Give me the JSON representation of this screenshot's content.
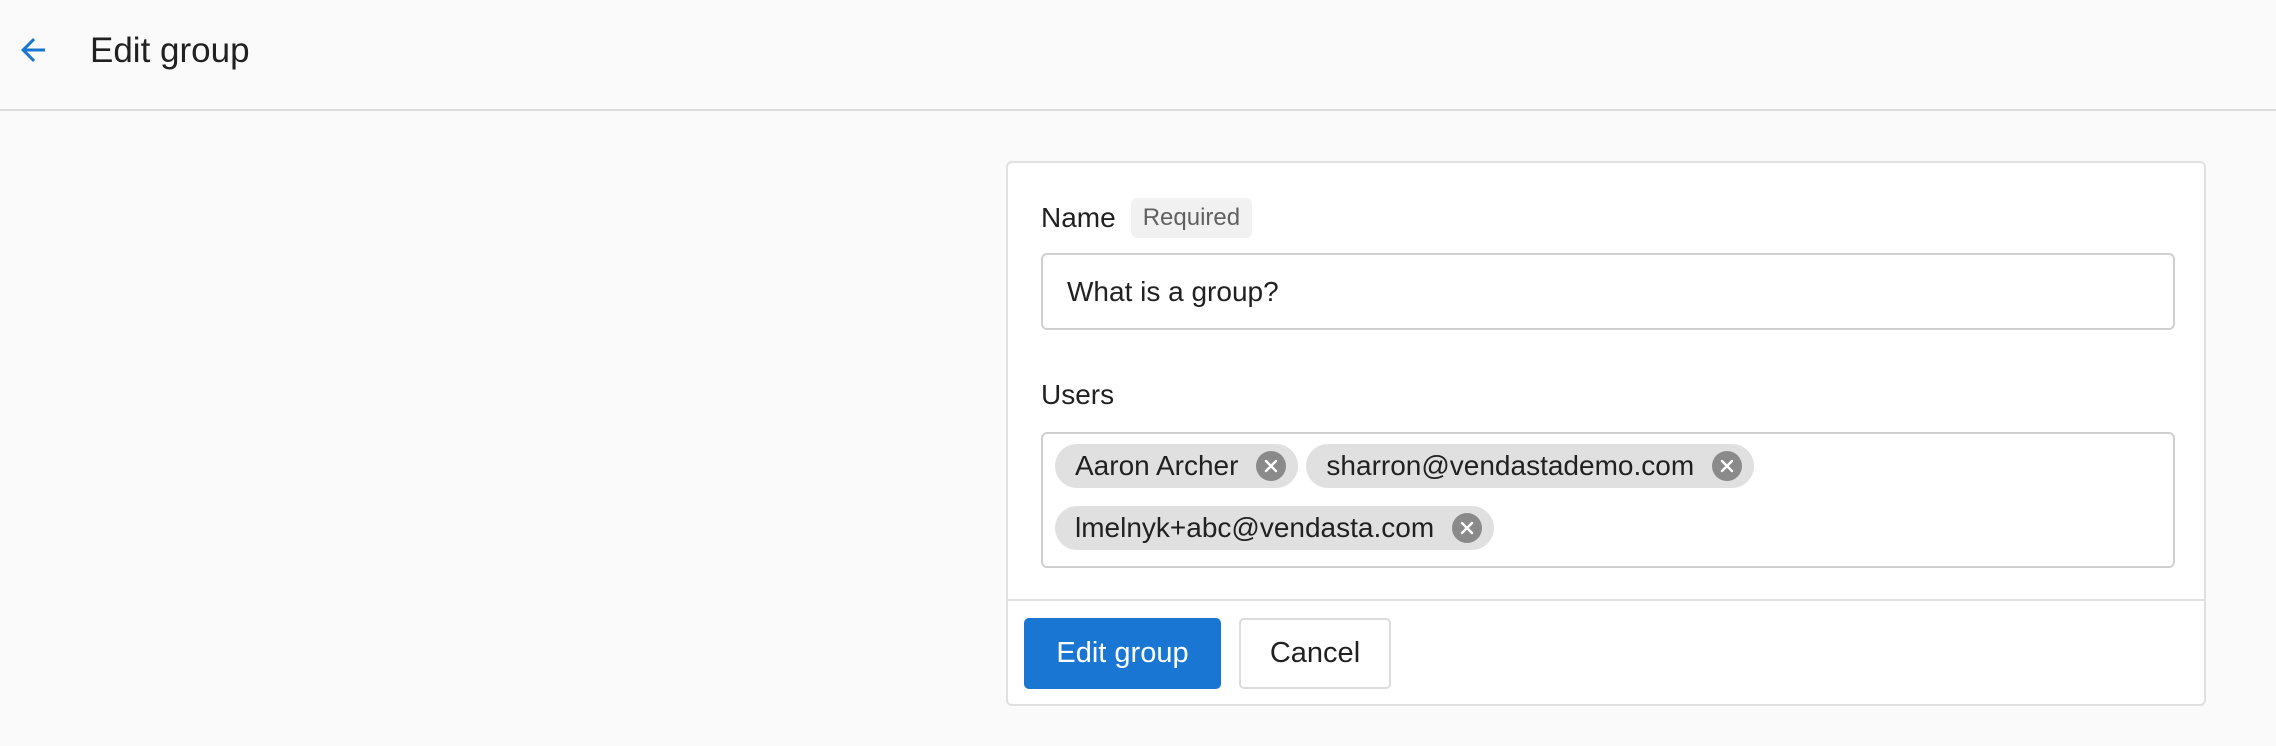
{
  "header": {
    "back_icon": "arrow-left-icon",
    "title": "Edit group",
    "accent_color": "#1976d2"
  },
  "form": {
    "name": {
      "label": "Name",
      "required_badge": "Required",
      "value": "What is a group?"
    },
    "users": {
      "label": "Users",
      "chips": [
        {
          "label": "Aaron Archer",
          "remove_icon": "close-circle-icon"
        },
        {
          "label": "sharron@vendastademo.com",
          "remove_icon": "close-circle-icon"
        },
        {
          "label": "lmelnyk+abc@vendasta.com",
          "remove_icon": "close-circle-icon"
        }
      ]
    }
  },
  "actions": {
    "submit_label": "Edit group",
    "cancel_label": "Cancel"
  }
}
